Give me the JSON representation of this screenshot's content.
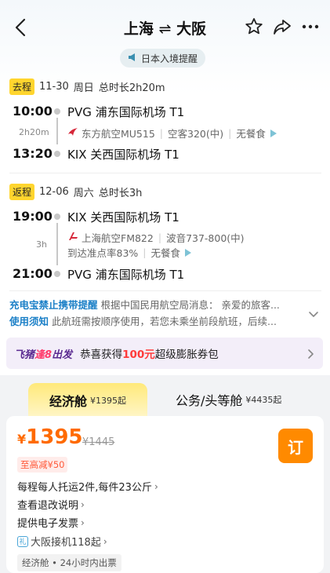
{
  "header": {
    "title_from": "上海",
    "title_arrow": "⇌",
    "title_to": "大阪"
  },
  "notice_pill": "日本入境提醒",
  "outbound": {
    "tag": "去程",
    "date": "11-30",
    "weekday": "周日",
    "total": "总时长2h20m",
    "depart_time": "10:00",
    "depart_airport": "PVG 浦东国际机场 T1",
    "duration": "2h20m",
    "airline": "东方航空MU515",
    "aircraft": "空客320(中)",
    "meal": "无餐食",
    "arrive_time": "13:20",
    "arrive_airport": "KIX 关西国际机场 T1"
  },
  "return": {
    "tag": "返程",
    "date": "12-06",
    "weekday": "周六",
    "total": "总时长3h",
    "depart_time": "19:00",
    "depart_airport": "KIX 关西国际机场 T1",
    "duration": "3h",
    "airline": "上海航空FM822",
    "aircraft": "波音737-800(中)",
    "ontime": "到达准点率83%",
    "meal": "无餐食",
    "arrive_time": "21:00",
    "arrive_airport": "PVG 浦东国际机场 T1"
  },
  "tips": [
    {
      "label": "充电宝禁止携带提醒",
      "text": "根据中国民用航空局消息：  亲爱的旅客..."
    },
    {
      "label": "使用须知",
      "text": "此航班需按顺序使用，若您未乘坐前段航班，后续..."
    }
  ],
  "promo": {
    "logo_a": "飞猪",
    "logo_b": "逢8",
    "logo_c": "出发",
    "text_pre": "恭喜获得",
    "amount": "100元",
    "text_post": "超级膨胀券包"
  },
  "tabs": [
    {
      "label": "经济舱",
      "sub": "¥1395起"
    },
    {
      "label": "公务/头等舱",
      "sub": "¥4435起"
    }
  ],
  "fare": {
    "currency": "¥",
    "price": "1395",
    "old_price": "¥1445",
    "book_label": "订",
    "discount": "至高减¥50",
    "baggage": "每程每人托运2件,每件23公斤",
    "refund": "查看退改说明",
    "invoice": "提供电子发票",
    "gift_icon": "礼",
    "transfer": "大阪接机118起",
    "cabin_note": "经济舱 • 24小时内出票"
  },
  "colors": {
    "accent_orange": "#ff8a00",
    "price_orange": "#ff6a00",
    "tip_blue": "#1a7fc7",
    "tag_yellow": "#ffd52e"
  },
  "icons": [
    "back-arrow-icon",
    "star-icon",
    "share-icon",
    "more-icon",
    "megaphone-icon",
    "airline-logo-icon",
    "play-triangle-icon",
    "chevron-down-icon",
    "chevron-right-icon",
    "gift-icon"
  ]
}
